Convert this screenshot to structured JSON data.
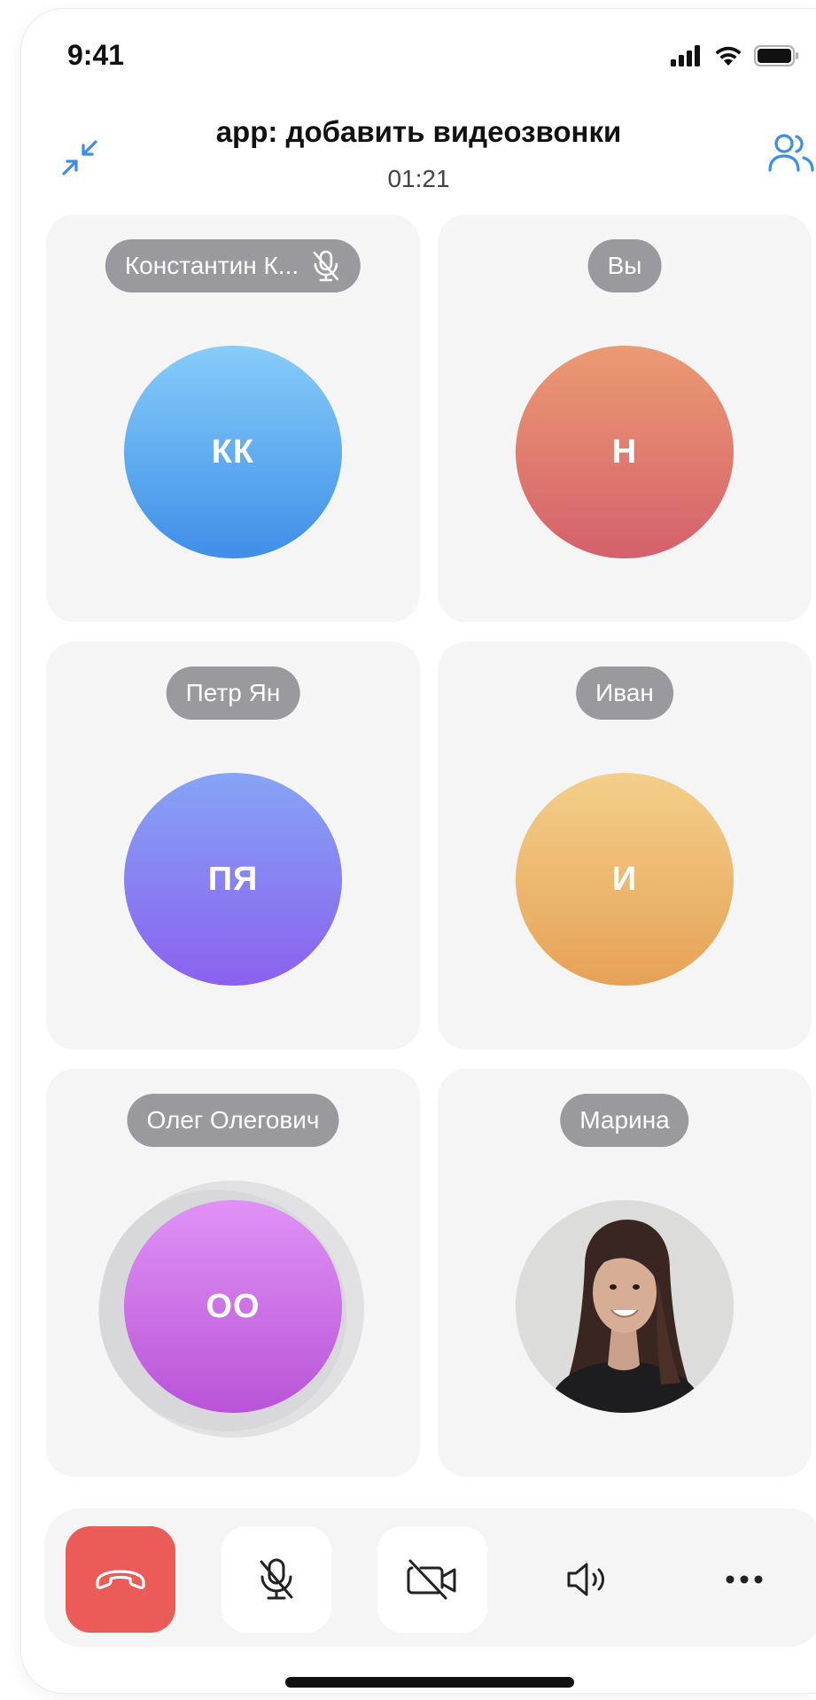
{
  "status_bar": {
    "time": "9:41",
    "icons": [
      "signal-icon",
      "wifi-icon",
      "battery-icon"
    ]
  },
  "header": {
    "title": "app: добавить видеозвонки",
    "timer": "01:21",
    "left_icon": "collapse-icon",
    "right_icon": "participants-icon"
  },
  "participants": [
    {
      "name": "Константин К...",
      "initials": "КК",
      "muted": true,
      "gradient": [
        "#86cdf9",
        "#3f8ee8"
      ]
    },
    {
      "name": "Вы",
      "initials": "Н",
      "muted": false,
      "gradient": [
        "#ec9b72",
        "#d4606c"
      ]
    },
    {
      "name": "Петр Ян",
      "initials": "ПЯ",
      "muted": false,
      "gradient": [
        "#86a4f5",
        "#8a61ef"
      ]
    },
    {
      "name": "Иван",
      "initials": "И",
      "muted": false,
      "gradient": [
        "#f3cf8a",
        "#e6a257"
      ]
    },
    {
      "name": "Олег Олегович",
      "initials": "ОО",
      "muted": false,
      "speaking": true,
      "gradient": [
        "#e092f6",
        "#b954d8"
      ]
    },
    {
      "name": "Марина",
      "initials": "",
      "muted": false,
      "photo": true
    }
  ],
  "controls": [
    {
      "name": "end-call",
      "icon": "phone-hangup-icon",
      "color": "#eb5b57"
    },
    {
      "name": "microphone",
      "icon": "microphone-off-icon"
    },
    {
      "name": "camera",
      "icon": "camera-off-icon"
    },
    {
      "name": "speaker",
      "icon": "speaker-icon"
    },
    {
      "name": "more",
      "icon": "more-dots-icon"
    }
  ],
  "colors": {
    "accent": "#3a8ee8",
    "tile_bg": "#f5f5f6",
    "pill_bg": "#9a9a9e",
    "end_call": "#eb5b57"
  }
}
